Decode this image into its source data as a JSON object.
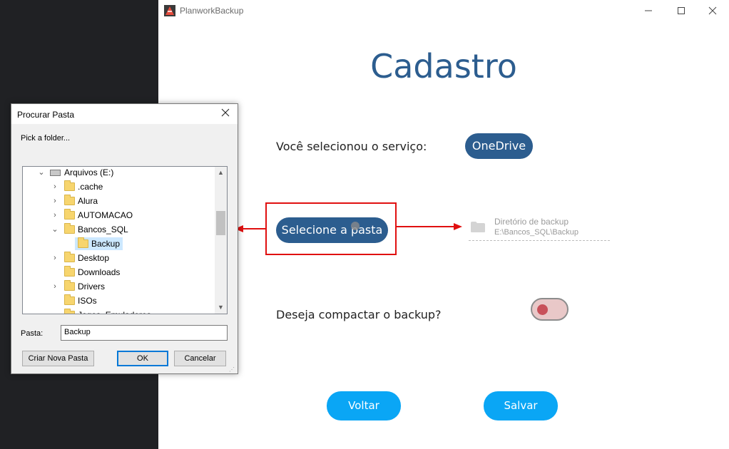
{
  "app": {
    "title": "PlanworkBackup",
    "window_controls": {
      "minimize": "—",
      "maximize": "☐",
      "close": "✕"
    },
    "heading": "Cadastro",
    "service_label": "Você selecionou o serviço:",
    "service_button": "OneDrive",
    "select_folder_button": "Selecione a pasta",
    "backup_dir": {
      "label": "Diretório de backup",
      "value": "E:\\Bancos_SQL\\Backup",
      "icon": "folder-icon"
    },
    "compress_label": "Deseja compactar o backup?",
    "compress_toggle_on": false,
    "back_button": "Voltar",
    "save_button": "Salvar"
  },
  "dialog": {
    "title": "Procurar Pasta",
    "close": "✕",
    "description": "Pick a folder...",
    "tree": [
      {
        "label": "Arquivos (E:)",
        "chevron": "⌄",
        "icon": "drive-icon"
      },
      {
        "label": ".cache",
        "chevron": "›",
        "icon": "folder-icon"
      },
      {
        "label": "Alura",
        "chevron": "›",
        "icon": "folder-icon"
      },
      {
        "label": "AUTOMACAO",
        "chevron": "›",
        "icon": "folder-icon"
      },
      {
        "label": "Bancos_SQL",
        "chevron": "⌄",
        "icon": "folder-icon"
      },
      {
        "label": "Backup",
        "chevron": "",
        "icon": "folder-icon",
        "selected": true
      },
      {
        "label": "Desktop",
        "chevron": "›",
        "icon": "folder-icon"
      },
      {
        "label": "Downloads",
        "chevron": "",
        "icon": "folder-icon"
      },
      {
        "label": "Drivers",
        "chevron": "›",
        "icon": "folder-icon"
      },
      {
        "label": "ISOs",
        "chevron": "",
        "icon": "folder-icon"
      },
      {
        "label": "Jogos_Emuladores",
        "chevron": "",
        "icon": "folder-icon"
      }
    ],
    "folder_label": "Pasta:",
    "folder_value": "Backup",
    "new_folder_button": "Criar Nova Pasta",
    "ok_button": "OK",
    "cancel_button": "Cancelar"
  },
  "colors": {
    "brand": "#2c5d8f",
    "action": "#0aa6f5",
    "annotation": "#e01010",
    "toggle_off": "#c8515a"
  }
}
